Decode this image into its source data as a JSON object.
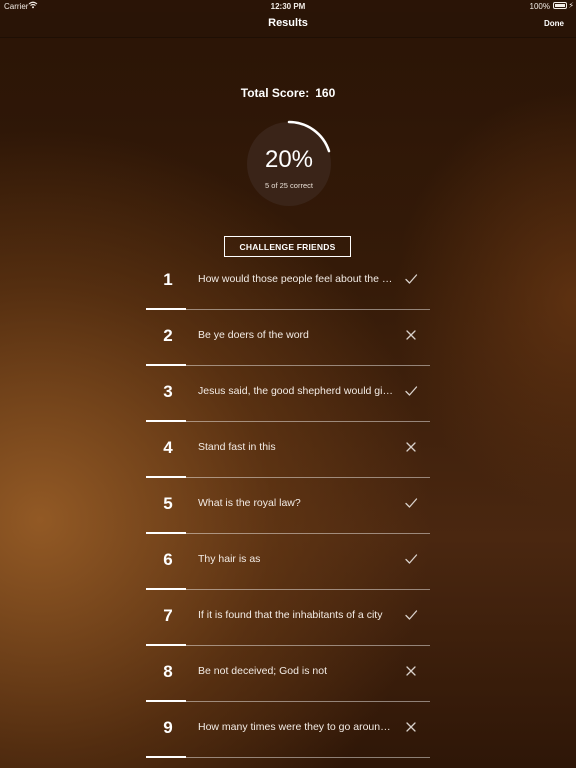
{
  "status": {
    "carrier": "Carrier",
    "time": "12:30 PM",
    "battery": "100%"
  },
  "nav": {
    "title": "Results",
    "done_label": "Done"
  },
  "score": {
    "label": "Total Score:",
    "value": "160"
  },
  "progress": {
    "percent_label": "20%",
    "subtitle": "5 of 25 correct",
    "fraction": 0.2
  },
  "challenge_label": "CHALLENGE FRIENDS",
  "results": [
    {
      "number": "1",
      "text": "How would those people feel about the gospel message?",
      "correct": true
    },
    {
      "number": "2",
      "text": "Be ye doers of the word",
      "correct": false
    },
    {
      "number": "3",
      "text": "Jesus said, the good shepherd would give his life for the sheep",
      "correct": true
    },
    {
      "number": "4",
      "text": "Stand fast in this",
      "correct": false
    },
    {
      "number": "5",
      "text": "What is the royal law?",
      "correct": true
    },
    {
      "number": "6",
      "text": "Thy hair is as",
      "correct": true
    },
    {
      "number": "7",
      "text": "If it is found that the inhabitants of a city",
      "correct": true
    },
    {
      "number": "8",
      "text": "Be not deceived; God is not",
      "correct": false
    },
    {
      "number": "9",
      "text": "How many times were they to go around the city?",
      "correct": false
    }
  ],
  "icons": {
    "correct": "checkmark-icon",
    "incorrect": "cross-icon",
    "wifi": "wifi-icon",
    "battery": "battery-icon"
  },
  "colors": {
    "ring_track": "#3a2418",
    "ring_fill": "#ffffff",
    "background": "#341a08"
  }
}
